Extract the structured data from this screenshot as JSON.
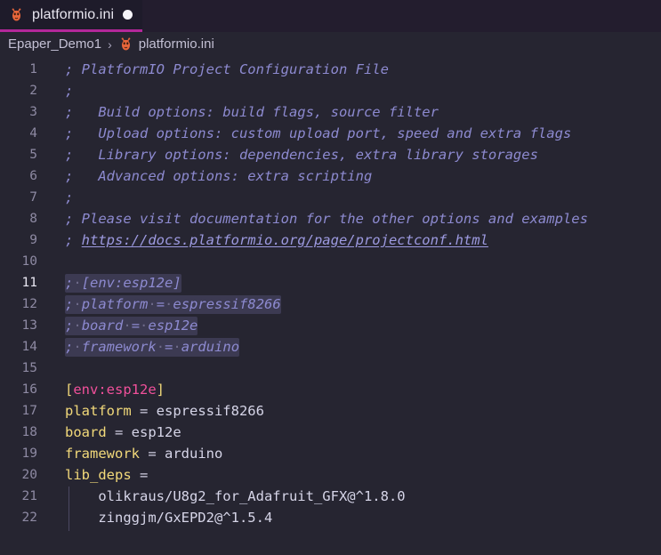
{
  "theme": {
    "tabbar_bg": "#231d2e",
    "tab_active_bg": "#1e1b2a",
    "tab_accent": "#b3279a",
    "editor_bg": "#262531",
    "selection_bg": "#3c3a52",
    "comment_color": "#8d8ad0",
    "key_color": "#f2d97a",
    "section_color": "#f0509a",
    "value_color": "#d6d5e8",
    "linenumber_color": "#8e8aa3",
    "linenumber_active_color": "#e9e7f2",
    "icon_color": "#e8663b"
  },
  "tab": {
    "icon": "platformio-ant-icon",
    "title": "platformio.ini",
    "dirty_indicator": "unsaved-changes-dot"
  },
  "breadcrumb": {
    "project": "Epaper_Demo1",
    "separator": "›",
    "file_icon": "platformio-ant-icon",
    "file": "platformio.ini"
  },
  "editor": {
    "active_line": 11,
    "selected_lines": [
      11,
      12,
      13,
      14
    ],
    "indent_guide_lines": [
      21,
      22
    ],
    "lines": [
      {
        "n": 1,
        "tokens": [
          {
            "t": "; PlatformIO Project Configuration File",
            "c": "cmt"
          }
        ]
      },
      {
        "n": 2,
        "tokens": [
          {
            "t": ";",
            "c": "cmt"
          }
        ]
      },
      {
        "n": 3,
        "tokens": [
          {
            "t": ";   Build options: build flags, source filter",
            "c": "cmt"
          }
        ]
      },
      {
        "n": 4,
        "tokens": [
          {
            "t": ";   Upload options: custom upload port, speed and extra flags",
            "c": "cmt"
          }
        ]
      },
      {
        "n": 5,
        "tokens": [
          {
            "t": ";   Library options: dependencies, extra library storages",
            "c": "cmt"
          }
        ]
      },
      {
        "n": 6,
        "tokens": [
          {
            "t": ";   Advanced options: extra scripting",
            "c": "cmt"
          }
        ]
      },
      {
        "n": 7,
        "tokens": [
          {
            "t": ";",
            "c": "cmt"
          }
        ]
      },
      {
        "n": 8,
        "tokens": [
          {
            "t": "; Please visit documentation for the other options and examples",
            "c": "cmt"
          }
        ]
      },
      {
        "n": 9,
        "tokens": [
          {
            "t": "; ",
            "c": "cmt"
          },
          {
            "t": "https://docs.platformio.org/page/projectconf.html",
            "c": "link"
          }
        ]
      },
      {
        "n": 10,
        "tokens": []
      },
      {
        "n": 11,
        "sel": true,
        "tokens": [
          {
            "t": ";",
            "c": "cmt"
          },
          {
            "t": "·",
            "c": "ws"
          },
          {
            "t": "[env:esp12e]",
            "c": "cmt"
          }
        ]
      },
      {
        "n": 12,
        "sel": true,
        "tokens": [
          {
            "t": ";",
            "c": "cmt"
          },
          {
            "t": "·",
            "c": "ws"
          },
          {
            "t": "platform",
            "c": "cmt"
          },
          {
            "t": "·",
            "c": "ws"
          },
          {
            "t": "=",
            "c": "cmt"
          },
          {
            "t": "·",
            "c": "ws"
          },
          {
            "t": "espressif8266",
            "c": "cmt"
          }
        ]
      },
      {
        "n": 13,
        "sel": true,
        "tokens": [
          {
            "t": ";",
            "c": "cmt"
          },
          {
            "t": "·",
            "c": "ws"
          },
          {
            "t": "board",
            "c": "cmt"
          },
          {
            "t": "·",
            "c": "ws"
          },
          {
            "t": "=",
            "c": "cmt"
          },
          {
            "t": "·",
            "c": "ws"
          },
          {
            "t": "esp12e",
            "c": "cmt"
          }
        ]
      },
      {
        "n": 14,
        "sel": true,
        "tokens": [
          {
            "t": ";",
            "c": "cmt"
          },
          {
            "t": "·",
            "c": "ws"
          },
          {
            "t": "framework",
            "c": "cmt"
          },
          {
            "t": "·",
            "c": "ws"
          },
          {
            "t": "=",
            "c": "cmt"
          },
          {
            "t": "·",
            "c": "ws"
          },
          {
            "t": "arduino",
            "c": "cmt"
          }
        ]
      },
      {
        "n": 15,
        "tokens": []
      },
      {
        "n": 16,
        "tokens": [
          {
            "t": "[",
            "c": "brk"
          },
          {
            "t": "env:esp12e",
            "c": "sect"
          },
          {
            "t": "]",
            "c": "brk"
          }
        ]
      },
      {
        "n": 17,
        "tokens": [
          {
            "t": "platform",
            "c": "key"
          },
          {
            "t": " = ",
            "c": "eq"
          },
          {
            "t": "espressif8266",
            "c": "val"
          }
        ]
      },
      {
        "n": 18,
        "tokens": [
          {
            "t": "board",
            "c": "key"
          },
          {
            "t": " = ",
            "c": "eq"
          },
          {
            "t": "esp12e",
            "c": "val"
          }
        ]
      },
      {
        "n": 19,
        "tokens": [
          {
            "t": "framework",
            "c": "key"
          },
          {
            "t": " = ",
            "c": "eq"
          },
          {
            "t": "arduino",
            "c": "val"
          }
        ]
      },
      {
        "n": 20,
        "tokens": [
          {
            "t": "lib_deps",
            "c": "key"
          },
          {
            "t": " =",
            "c": "eq"
          }
        ]
      },
      {
        "n": 21,
        "indent": true,
        "tokens": [
          {
            "t": "    olikraus/U8g2_for_Adafruit_GFX@^1.8.0",
            "c": "plain"
          }
        ]
      },
      {
        "n": 22,
        "indent": true,
        "tokens": [
          {
            "t": "    zinggjm/GxEPD2@^1.5.4",
            "c": "plain"
          }
        ]
      }
    ]
  }
}
